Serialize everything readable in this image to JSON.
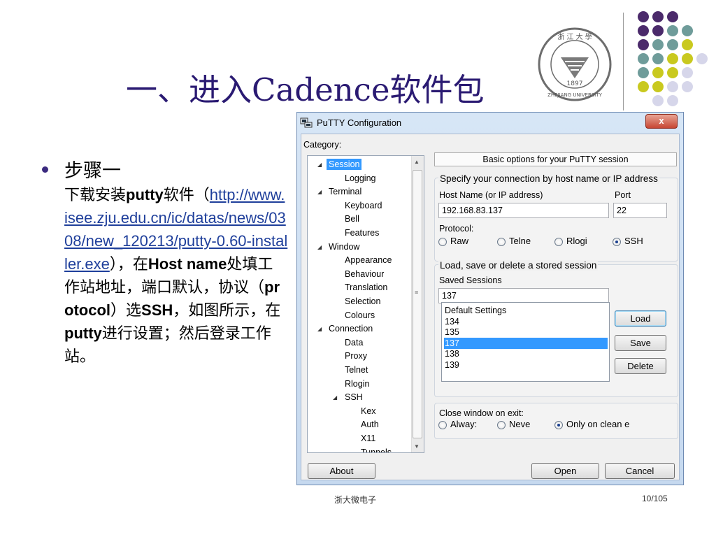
{
  "slide": {
    "title": "一、进入Cadence软件包",
    "bullet_heading": "步骤一",
    "body": {
      "t1": "下载安装",
      "b1": "putty",
      "t2": "软件（",
      "link": "http://www.isee.zju.edu.cn/ic/datas/news/0308/new_120213/putty-0.60-installer.exe",
      "t3": "），在",
      "b2": "Host name",
      "t4": "处填工作站地址，端口默认，协议（",
      "b3": "protocol",
      "t5": "）选",
      "b4": "SSH",
      "t6": "，如图所示，在",
      "b5": "putty",
      "t7": "进行设置；然后登录工作站。"
    },
    "footer_center": "浙大微电子",
    "footer_right": "10/105",
    "logo": {
      "year": "1897",
      "name": "ZHEJIANG UNIVERSITY",
      "chars": "浙 江 大 學"
    },
    "colors": {
      "title": "#2a1a72",
      "purple": "#4b2a6b",
      "teal": "#6f9c9a",
      "lime": "#c9c91f",
      "lavender": "#d6d6ea",
      "link": "#1f3f9b"
    }
  },
  "putty": {
    "title": "PuTTY Configuration",
    "close_label": "x",
    "category_label": "Category:",
    "tree": [
      {
        "label": "Session",
        "selected": true
      },
      {
        "label": "Logging"
      },
      {
        "label": "Terminal"
      },
      {
        "label": "Keyboard"
      },
      {
        "label": "Bell"
      },
      {
        "label": "Features"
      },
      {
        "label": "Window"
      },
      {
        "label": "Appearance"
      },
      {
        "label": "Behaviour"
      },
      {
        "label": "Translation"
      },
      {
        "label": "Selection"
      },
      {
        "label": "Colours"
      },
      {
        "label": "Connection"
      },
      {
        "label": "Data"
      },
      {
        "label": "Proxy"
      },
      {
        "label": "Telnet"
      },
      {
        "label": "Rlogin"
      },
      {
        "label": "SSH"
      },
      {
        "label": "Kex"
      },
      {
        "label": "Auth"
      },
      {
        "label": "X11"
      },
      {
        "label": "Tunnels"
      }
    ],
    "heading": "Basic options for your PuTTY session",
    "group1_title": "Specify your connection by host name or IP address",
    "host_label": "Host Name (or IP address)",
    "port_label": "Port",
    "host_value": "192.168.83.137",
    "port_value": "22",
    "protocol_label": "Protocol:",
    "protocols": [
      {
        "label": "Raw",
        "checked": false
      },
      {
        "label": "Telne",
        "checked": false
      },
      {
        "label": "Rlogi",
        "checked": false
      },
      {
        "label": "SSH",
        "checked": true
      }
    ],
    "group2_title": "Load, save or delete a stored session",
    "saved_label": "Saved Sessions",
    "saved_value": "137",
    "sessions": [
      {
        "label": "Default Settings"
      },
      {
        "label": "134"
      },
      {
        "label": "135"
      },
      {
        "label": "137",
        "selected": true
      },
      {
        "label": "138"
      },
      {
        "label": "139"
      }
    ],
    "load_label": "Load",
    "save_label": "Save",
    "delete_label": "Delete",
    "close_window_label": "Close window on exit:",
    "exit_options": [
      {
        "label": "Alway:",
        "checked": false
      },
      {
        "label": "Neve",
        "checked": false
      },
      {
        "label": "Only on clean e",
        "checked": true
      }
    ],
    "about_label": "About",
    "open_label": "Open",
    "cancel_label": "Cancel"
  }
}
